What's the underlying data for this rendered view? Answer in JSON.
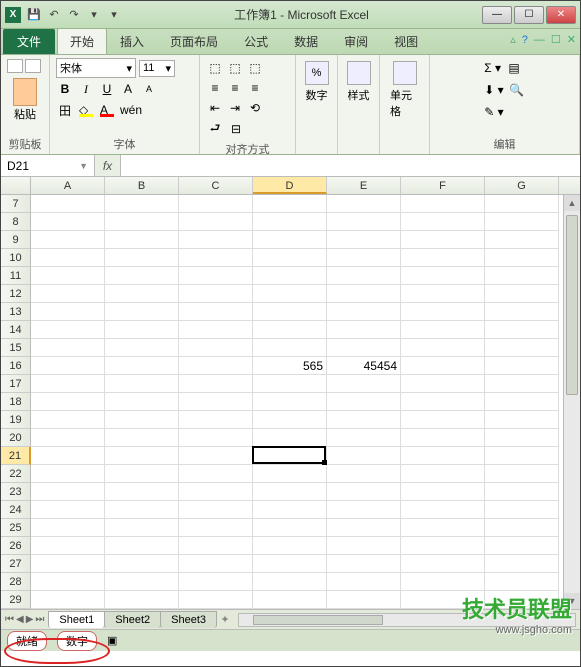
{
  "title": "工作簿1 - Microsoft Excel",
  "qat": {
    "save": "💾",
    "undo": "↶",
    "redo": "↷"
  },
  "tabs": {
    "file": "文件",
    "items": [
      "开始",
      "插入",
      "页面布局",
      "公式",
      "数据",
      "审阅",
      "视图"
    ],
    "active": 0
  },
  "ribbon": {
    "clipboard": {
      "label": "剪贴板",
      "paste": "粘贴"
    },
    "font": {
      "label": "字体",
      "name": "宋体",
      "size": "11",
      "bold": "B",
      "italic": "I",
      "underline": "U"
    },
    "align": {
      "label": "对齐方式"
    },
    "number": {
      "label": "数字",
      "btn": "%"
    },
    "styles": {
      "label": "样式"
    },
    "cells": {
      "label": "单元格"
    },
    "editing": {
      "label": "编辑",
      "sum": "Σ ▾",
      "fill": "⬇ ▾",
      "clear": "✎ ▾",
      "sort": "▤",
      "find": "🔍"
    }
  },
  "namebox": "D21",
  "fx": "fx",
  "columns": [
    "A",
    "B",
    "C",
    "D",
    "E",
    "F",
    "G"
  ],
  "selectedCol": "D",
  "rows": [
    7,
    8,
    9,
    10,
    11,
    12,
    13,
    14,
    15,
    16,
    17,
    18,
    19,
    20,
    21,
    22,
    23,
    24,
    25,
    26,
    27,
    28,
    29
  ],
  "selectedRow": 21,
  "cells": {
    "D16": "565",
    "E16": "45454"
  },
  "sheets": {
    "list": [
      "Sheet1",
      "Sheet2",
      "Sheet3"
    ],
    "active": 0
  },
  "status": {
    "ready": "就绪",
    "mode": "数字"
  },
  "watermark": {
    "text": "技术员联盟",
    "url": "www.jsgho.com"
  }
}
